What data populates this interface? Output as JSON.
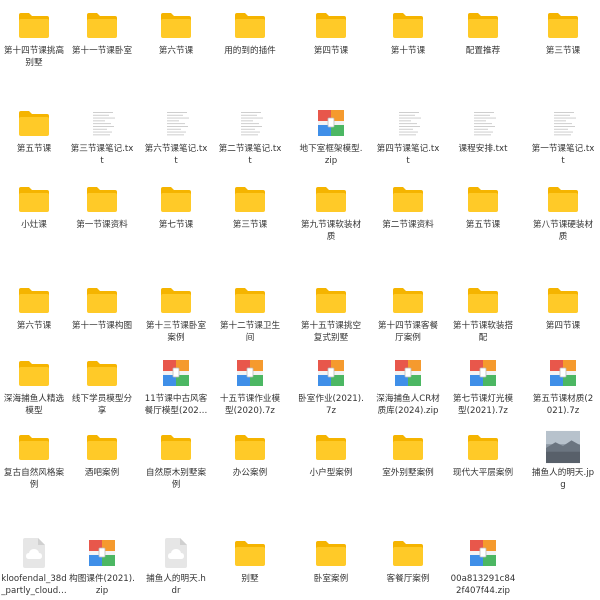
{
  "colors": {
    "folder_back": "#f5b400",
    "folder_front": "#ffca28",
    "zip_red": "#e8574b",
    "zip_orange": "#f59a2e",
    "zip_blue": "#3f8fe8",
    "zip_green": "#4cb763",
    "txt_line": "#c9c9c9"
  },
  "rows": [
    [
      {
        "type": "folder",
        "label": "第十四节课挑高\n别墅"
      },
      {
        "type": "folder",
        "label": "第十一节课卧室"
      },
      {
        "type": "folder",
        "label": "第六节课"
      },
      {
        "type": "folder",
        "label": "用的到的插件"
      },
      {
        "type": "folder",
        "label": "第四节课"
      },
      {
        "type": "folder",
        "label": "第十节课"
      },
      {
        "type": "folder",
        "label": "配置推荐"
      },
      {
        "type": "folder",
        "label": "第三节课"
      }
    ],
    [
      {
        "type": "folder",
        "label": "第五节课"
      },
      {
        "type": "txt",
        "label": "第三节课笔记.tx\nt"
      },
      {
        "type": "txt",
        "label": "第六节课笔记.tx\nt"
      },
      {
        "type": "txt",
        "label": "第二节课笔记.tx\nt"
      },
      {
        "type": "zip",
        "label": "地下室框架模型.\nzip"
      },
      {
        "type": "txt",
        "label": "第四节课笔记.tx\nt"
      },
      {
        "type": "txt",
        "label": "课程安排.txt"
      },
      {
        "type": "txt",
        "label": "第一节课笔记.tx\nt"
      }
    ],
    [
      {
        "type": "folder",
        "label": "小灶课"
      },
      {
        "type": "folder",
        "label": "第一节课资料"
      },
      {
        "type": "folder",
        "label": "第七节课"
      },
      {
        "type": "folder",
        "label": "第三节课"
      },
      {
        "type": "folder",
        "label": "第九节课软装材\n质"
      },
      {
        "type": "folder",
        "label": "第二节课资料"
      },
      {
        "type": "folder",
        "label": "第五节课"
      },
      {
        "type": "folder",
        "label": "第八节课硬装材\n质"
      }
    ],
    [
      {
        "type": "folder",
        "label": "第六节课"
      },
      {
        "type": "folder",
        "label": "第十一节课构图"
      },
      {
        "type": "folder",
        "label": "第十三节课卧室\n案例"
      },
      {
        "type": "folder",
        "label": "第十二节课卫生\n间"
      },
      {
        "type": "folder",
        "label": "第十五节课挑空\n复式别墅"
      },
      {
        "type": "folder",
        "label": "第十四节课客餐\n厅案例"
      },
      {
        "type": "folder",
        "label": "第十节课软装搭\n配"
      },
      {
        "type": "folder",
        "label": "第四节课"
      }
    ],
    [
      {
        "type": "folder",
        "label": "深海捕鱼人精选\n模型"
      },
      {
        "type": "folder",
        "label": "线下学员模型分\n享"
      },
      {
        "type": "zip",
        "label": "11节课中古风客\n餐厅模型(202…"
      },
      {
        "type": "zip",
        "label": "十五节课作业模\n型(2020).7z"
      },
      {
        "type": "zip",
        "label": "卧室作业(2021).\n7z"
      },
      {
        "type": "zip",
        "label": "深海捕鱼人CR材\n质库(2024).zip"
      },
      {
        "type": "zip",
        "label": "第七节课灯光模\n型(2021).7z"
      },
      {
        "type": "zip",
        "label": "第五节课材质(2\n021).7z"
      }
    ],
    [
      {
        "type": "folder",
        "label": "复古自然风格案\n例"
      },
      {
        "type": "folder",
        "label": "酒吧案例"
      },
      {
        "type": "folder",
        "label": "自然原木别墅案\n例"
      },
      {
        "type": "folder",
        "label": "办公案例"
      },
      {
        "type": "folder",
        "label": "小户型案例"
      },
      {
        "type": "folder",
        "label": "室外别墅案例"
      },
      {
        "type": "folder",
        "label": "现代大平层案例"
      },
      {
        "type": "image",
        "label": "捕鱼人的明天.jp\ng"
      }
    ],
    [
      {
        "type": "cloud",
        "label": "kloofendal_38d\n_partly_cloud…"
      },
      {
        "type": "zip",
        "label": "构图课件(2021).\nzip"
      },
      {
        "type": "cloud",
        "label": "捕鱼人的明天.h\ndr"
      },
      {
        "type": "folder",
        "label": "别墅"
      },
      {
        "type": "folder",
        "label": "卧室案例"
      },
      {
        "type": "folder",
        "label": "客餐厅案例"
      },
      {
        "type": "zip",
        "label": "00a813291c84\n2f407f44.zip"
      }
    ]
  ]
}
